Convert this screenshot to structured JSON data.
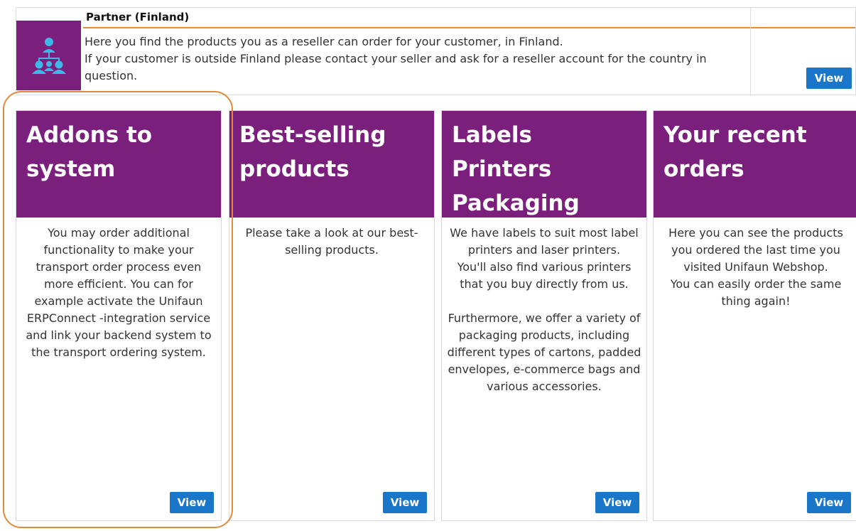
{
  "partner": {
    "title": "Partner (Finland)",
    "desc_line1": "Here you find the products you as a reseller can order for your customer, in Finland.",
    "desc_line2": "If your customer is outside Finland please contact your seller and ask for a reseller account for the country in question.",
    "view_label": "View",
    "icon": "users-network-icon"
  },
  "cards": [
    {
      "title": "Addons to system",
      "body": "You may order additional functionality to make your transport order process even more efficient. You can for example activate the Unifaun ERPConnect -integration service and link your backend system to the transport ordering system.",
      "view_label": "View"
    },
    {
      "title": "Best-selling products",
      "body": "Please take a look at our best-selling products.",
      "view_label": "View"
    },
    {
      "title": "Labels Printers Packaging",
      "body": "We have labels to suit most label printers and laser printers.\nYou'll also find various printers that you buy directly from us.\n\nFurthermore, we offer a variety of packaging products, including different types of cartons, padded envelopes, e-commerce bags and various accessories.",
      "view_label": "View"
    },
    {
      "title": "Your recent orders",
      "body": "Here you can see the products you ordered the last time you visited Unifaun Webshop.\nYou can easily order the same thing again!",
      "view_label": "View"
    }
  ],
  "colors": {
    "brand_purple": "#7b1f7d",
    "button_blue": "#1a76c9",
    "accent_orange": "#e8892b"
  }
}
